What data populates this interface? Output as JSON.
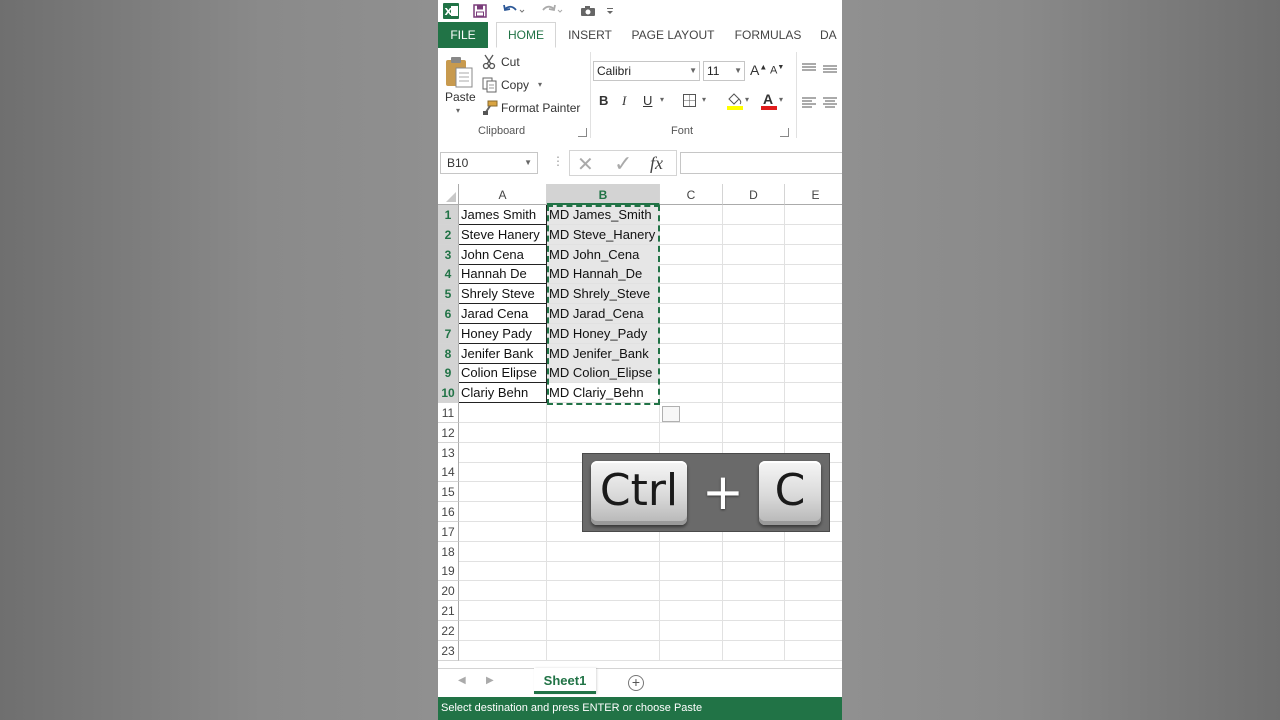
{
  "window": {
    "tabs": [
      "FILE",
      "HOME",
      "INSERT",
      "PAGE LAYOUT",
      "FORMULAS",
      "DA"
    ],
    "active_tab": "HOME"
  },
  "ribbon": {
    "clipboard": {
      "paste": "Paste",
      "cut": "Cut",
      "copy": "Copy",
      "format_painter": "Format Painter",
      "label": "Clipboard"
    },
    "font": {
      "name": "Calibri",
      "size": "11",
      "bold": "B",
      "italic": "I",
      "underline": "U",
      "label": "Font"
    }
  },
  "formula_bar": {
    "name_box": "B10",
    "cancel": "✕",
    "enter": "✓",
    "fx": "fx",
    "value": ""
  },
  "grid": {
    "columns": [
      "A",
      "B",
      "C",
      "D",
      "E"
    ],
    "rows": [
      "1",
      "2",
      "3",
      "4",
      "5",
      "6",
      "7",
      "8",
      "9",
      "10",
      "11",
      "12",
      "13",
      "14",
      "15",
      "16",
      "17",
      "18",
      "19",
      "20",
      "21",
      "22",
      "23"
    ],
    "col_a": [
      "James Smith",
      "Steve Hanery",
      "John Cena",
      "Hannah De",
      "Shrely Steve",
      "Jarad Cena",
      "Honey Pady",
      "Jenifer Bank",
      "Colion Elipse",
      "Clariy Behn"
    ],
    "col_b": [
      "MD James_Smith",
      "MD Steve_Hanery",
      "MD John_Cena",
      "MD Hannah_De",
      "MD Shrely_Steve",
      "MD Jarad_Cena",
      "MD Honey_Pady",
      "MD Jenifer_Bank",
      "MD Colion_Elipse",
      "MD Clariy_Behn"
    ]
  },
  "sheets": {
    "tabs": [
      "Sheet1"
    ],
    "add": "+"
  },
  "status": {
    "message": "Select destination and press ENTER or choose Paste"
  },
  "overlay": {
    "key1": "Ctrl",
    "plus": "+",
    "key2": "C"
  },
  "colors": {
    "accent": "#217346",
    "selection_fill": "#e6e6e6"
  }
}
